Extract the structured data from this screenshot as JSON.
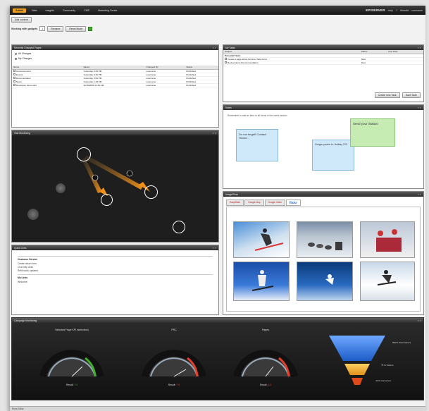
{
  "topbar": {
    "tabs": [
      "Admin",
      "Web",
      "Insights",
      "Community",
      "CMS",
      "Marketing Center"
    ],
    "brand": "EPISERVER",
    "items": [
      "Help",
      "?",
      "Website",
      "username"
    ]
  },
  "toolbar": {
    "add_button": "Add content",
    "label": "Working with gadgets",
    "selected": "1",
    "rename_button": "Rename",
    "reset_button": "Reset Mode"
  },
  "recently_changed": {
    "title": "Recently Changed Pages",
    "radio_all": "All Changes",
    "radio_mine": "My Changes",
    "columns": [
      "Name",
      "Saved",
      "Changed By",
      "Status"
    ],
    "rows": [
      [
        "Announcement",
        "Yesterday 3:49 PM",
        "username",
        "Published"
      ],
      [
        "Events",
        "Yesterday 3:49 PM",
        "username",
        "Published"
      ],
      [
        "Documentation",
        "Yesterday 3:50 PM",
        "username",
        "Published"
      ],
      [
        "News",
        "Yesterday 1:18 PM",
        "username",
        "Published"
      ],
      [
        "Developer demo wiki",
        "11/18/2009 11:39 AM",
        "username",
        "Published"
      ]
    ]
  },
  "tasks": {
    "title": "My Tasks",
    "columns": [
      "Subject",
      "Status",
      "Due Date"
    ],
    "group": "Personal Tasks",
    "rows": [
      [
        "Create a page about Summer Sale items",
        "New"
      ],
      [
        "Review items Recommendation",
        "New"
      ]
    ],
    "buttons": [
      "Create new Task",
      "Save Note"
    ]
  },
  "visit_monitoring": {
    "title": "Visit Monitoring"
  },
  "notes": {
    "title": "Notes",
    "hint": "Remember to add an item to all forms in the users section",
    "note1": "Do not forget! Contact House...",
    "note2": "Google photos to: Holiday 123",
    "note3": "Send your Status!"
  },
  "quick_links": {
    "title": "Quick Links",
    "groups": [
      {
        "name": "Customer Service",
        "links": [
          "Create return form",
          "Chat help desk",
          "Refill stock updated"
        ]
      },
      {
        "name": "My Links",
        "links": [
          "Welcome"
        ]
      }
    ]
  },
  "slideshow": {
    "title": "ImageShow",
    "tabs": [
      "EasySlider",
      "Google Map",
      "Google Video",
      "flickr"
    ]
  },
  "campaign": {
    "title": "Campaign Monitoring",
    "gauges": [
      {
        "label": "Selected Page KPI (selection)",
        "result_label": "Result:",
        "result": "7.0"
      },
      {
        "label": "PRC",
        "result_label": "Result:",
        "result": "7.5"
      },
      {
        "label": "Pages",
        "result_label": "Result:",
        "result": "4.5"
      }
    ],
    "funnel": [
      "50077 Total Visitors",
      "78 % Visitors",
      "44 % Converted"
    ]
  },
  "status": {
    "text": "Runs Editor"
  },
  "colors": {
    "accent": "#f0a020",
    "ok": "#3fae2a",
    "warn": "#e0402a"
  }
}
